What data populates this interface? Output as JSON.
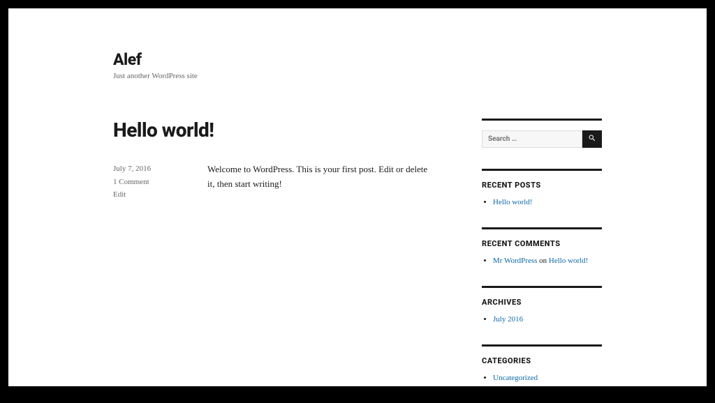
{
  "header": {
    "site_title": "Alef",
    "tagline": "Just another WordPress site"
  },
  "post": {
    "title": "Hello world!",
    "date": "July 7, 2016",
    "comments": "1 Comment",
    "edit": "Edit",
    "content": "Welcome to WordPress. This is your first post. Edit or delete it, then start writing!"
  },
  "search": {
    "placeholder": "Search …"
  },
  "widgets": {
    "recent_posts": {
      "title": "RECENT POSTS",
      "items": [
        "Hello world!"
      ]
    },
    "recent_comments": {
      "title": "RECENT COMMENTS",
      "author": "Mr WordPress",
      "on": " on ",
      "post": "Hello world!"
    },
    "archives": {
      "title": "ARCHIVES",
      "items": [
        "July 2016"
      ]
    },
    "categories": {
      "title": "CATEGORIES",
      "items": [
        "Uncategorized"
      ]
    }
  }
}
